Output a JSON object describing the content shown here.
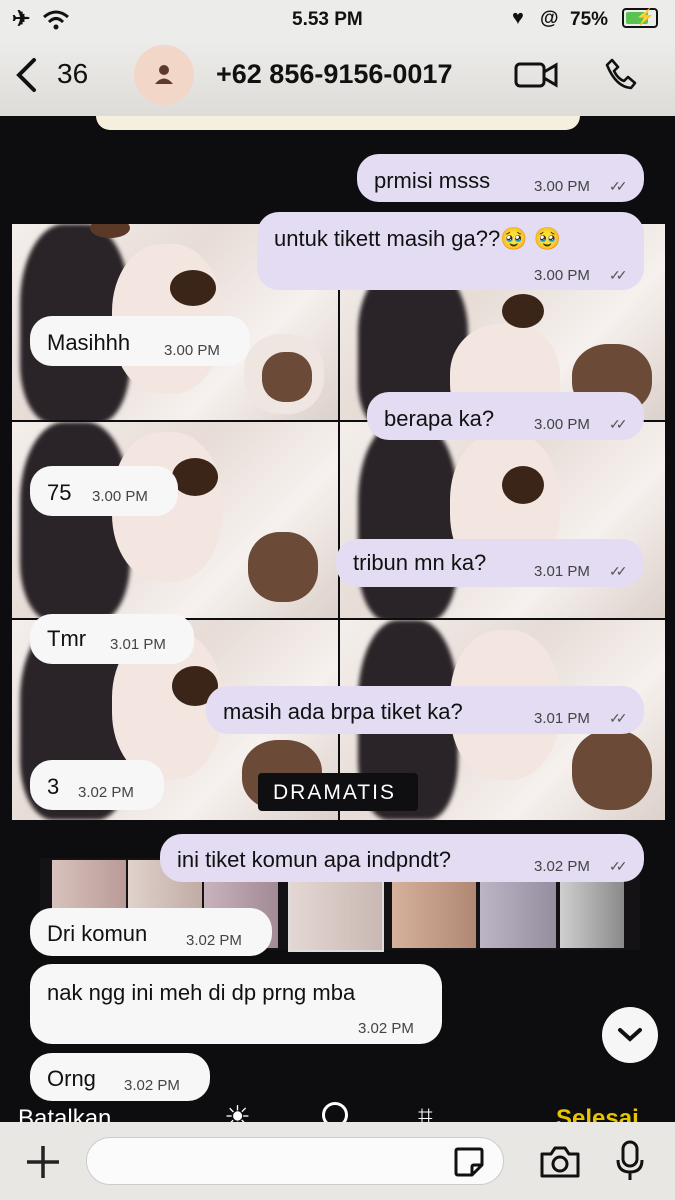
{
  "status": {
    "time": "5.53 PM",
    "battery": "75%"
  },
  "header": {
    "back_count": "36",
    "contact": "+62 856-9156-0017"
  },
  "messages": [
    {
      "dir": "out",
      "text": "prmisi msss",
      "time": "3.00 PM"
    },
    {
      "dir": "out",
      "text": "untuk tikett masih ga??🥹 🥹",
      "time": "3.00 PM"
    },
    {
      "dir": "in",
      "text": "Masihhh",
      "time": "3.00 PM"
    },
    {
      "dir": "out",
      "text": "berapa ka?",
      "time": "3.00 PM"
    },
    {
      "dir": "in",
      "text": "75",
      "time": "3.00 PM"
    },
    {
      "dir": "out",
      "text": "tribun mn ka?",
      "time": "3.01 PM"
    },
    {
      "dir": "in",
      "text": "Tmr",
      "time": "3.01 PM"
    },
    {
      "dir": "out",
      "text": "masih ada brpa tiket ka?",
      "time": "3.01 PM"
    },
    {
      "dir": "in",
      "text": "3",
      "time": "3.02 PM"
    },
    {
      "dir": "out",
      "text": "ini tiket komun apa indpndt?",
      "time": "3.02 PM"
    },
    {
      "dir": "in",
      "text": "Dri komun",
      "time": "3.02 PM"
    },
    {
      "dir": "in",
      "text": "nak ngg ini meh di dp prng mba",
      "time": "3.02 PM"
    },
    {
      "dir": "in",
      "text": "Orng",
      "time": "3.02 PM"
    }
  ],
  "overlay": {
    "filter_label": "DRAMATIS",
    "cancel": "Batalkan",
    "done": "Selesai"
  },
  "colors": {
    "outgoing": "#e3dcf2",
    "incoming": "#f7f7f7",
    "done": "#e6c400"
  }
}
